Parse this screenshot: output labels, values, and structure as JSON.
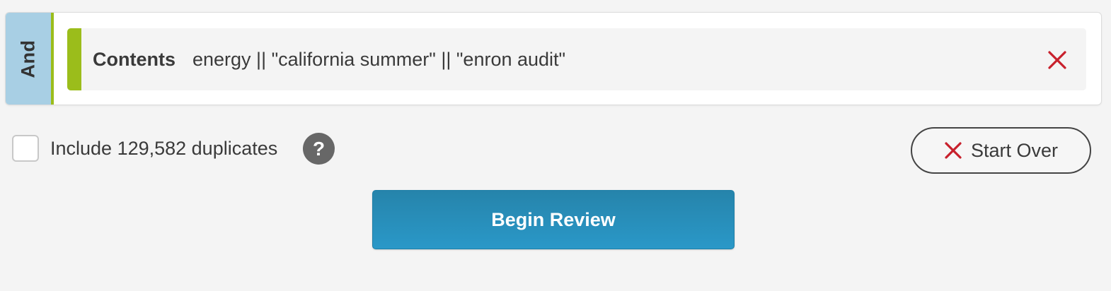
{
  "query": {
    "operator": "And",
    "condition": {
      "field": "Contents",
      "value": "energy || \"california summer\" || \"enron audit\"",
      "remove_icon": "close-x-icon"
    }
  },
  "duplicates": {
    "checked": false,
    "label": "Include 129,582 duplicates",
    "help_icon": "?"
  },
  "actions": {
    "start_over_label": "Start Over",
    "begin_review_label": "Begin Review"
  },
  "colors": {
    "operator_tab": "#a8cfe4",
    "condition_accent": "#9bbd1b",
    "remove_red": "#c8202c",
    "primary_button": "#2a8fbb",
    "help_badge": "#676767"
  }
}
